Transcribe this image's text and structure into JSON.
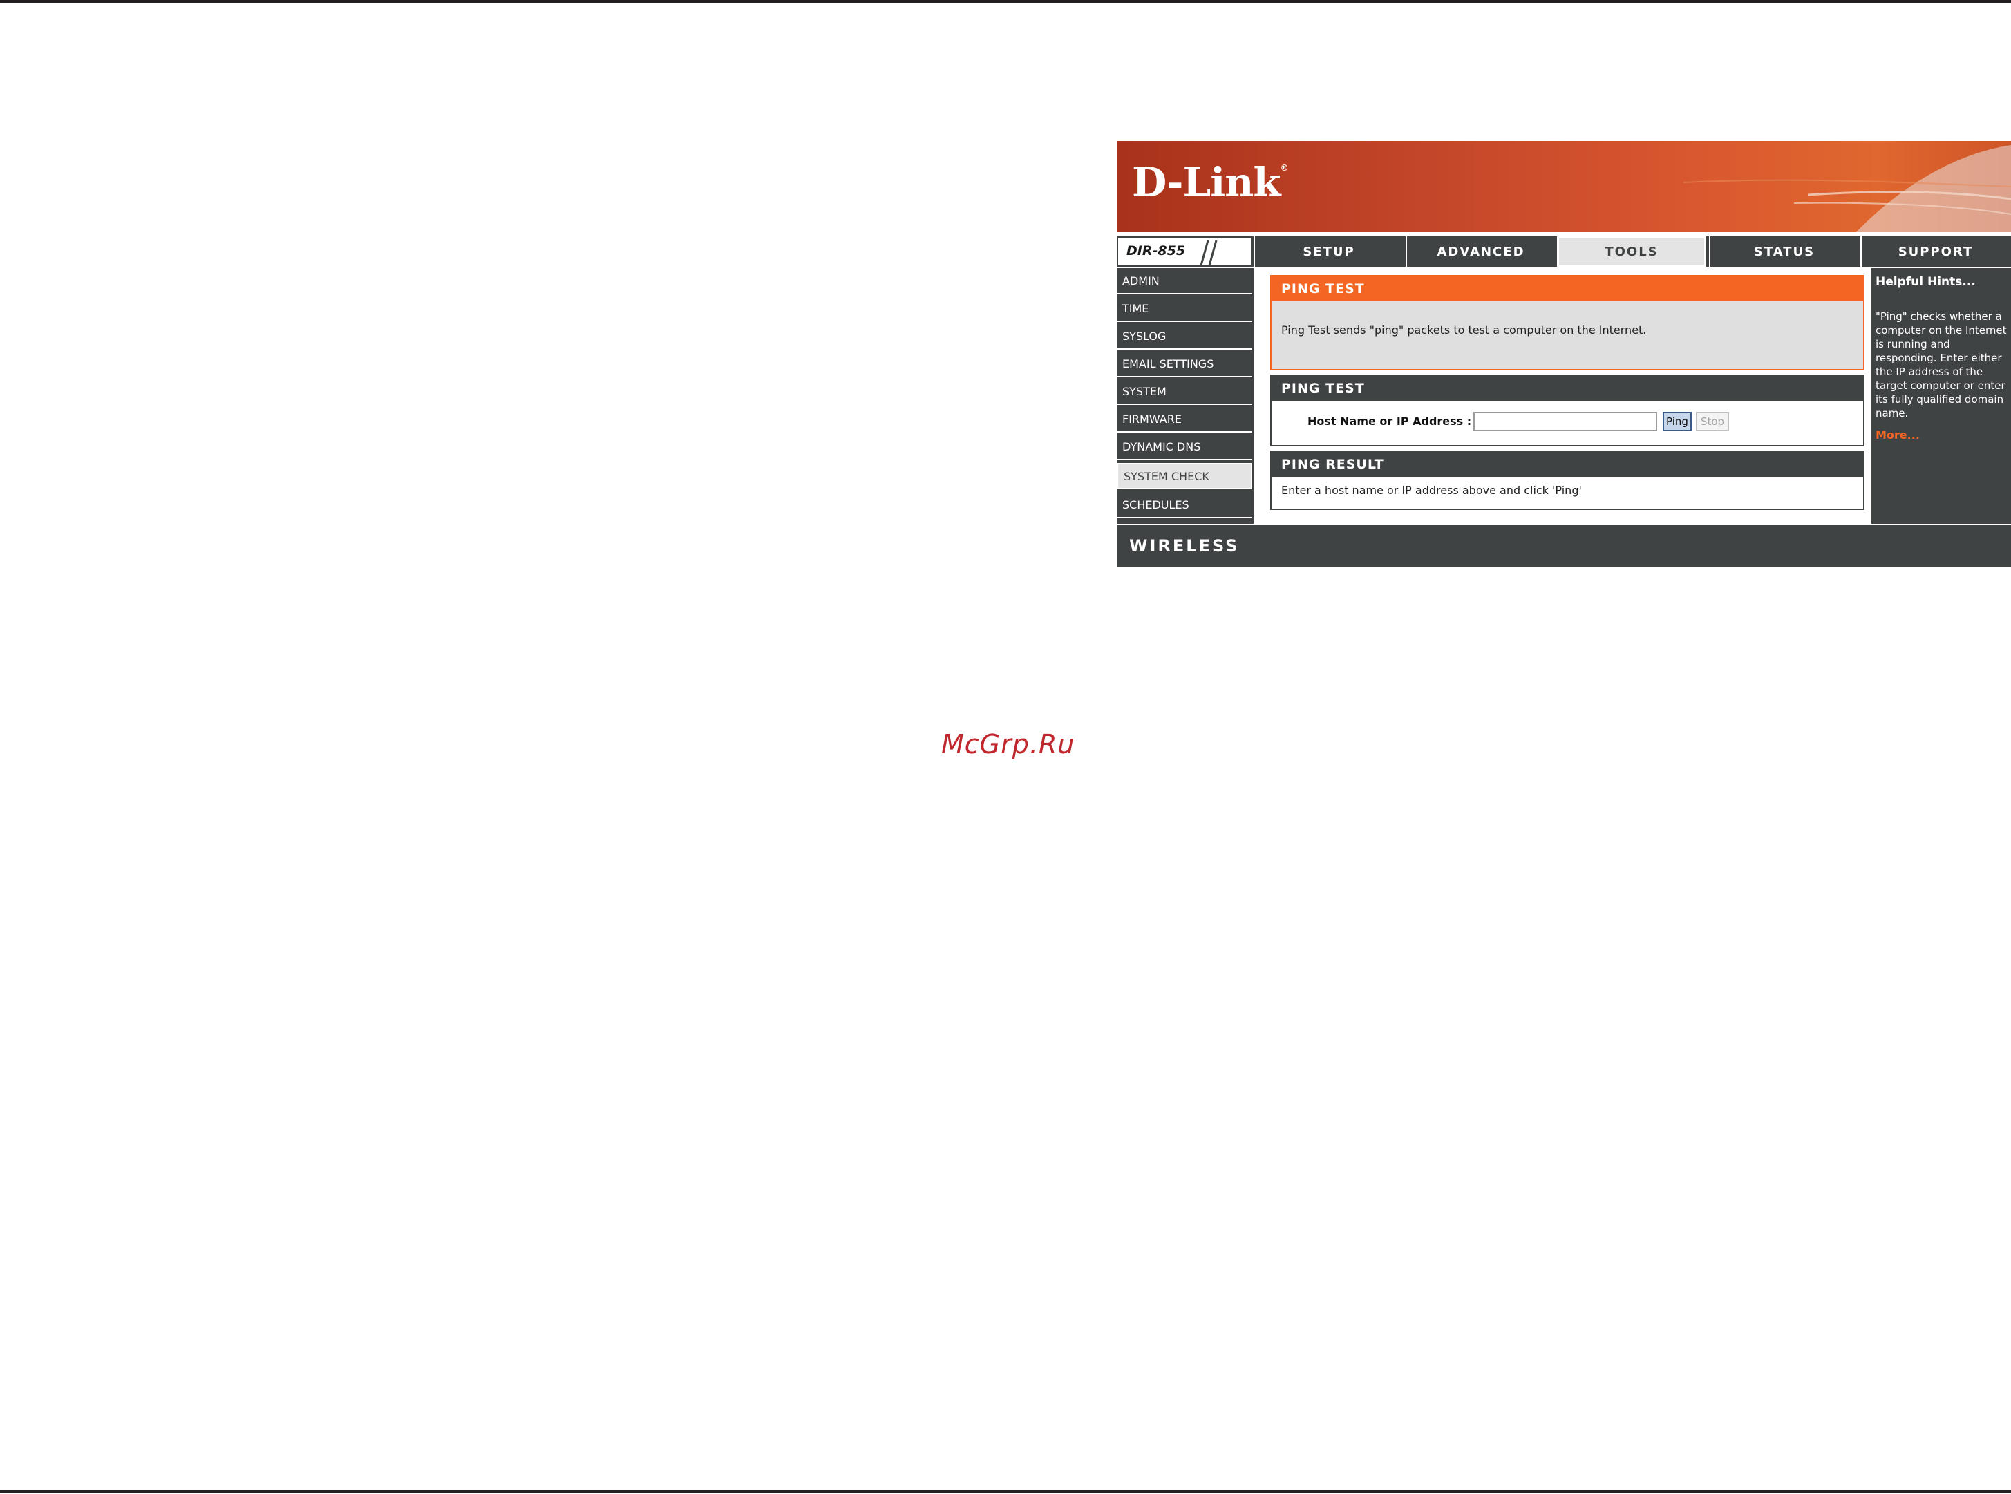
{
  "brand": {
    "logo": "D-Link",
    "registered": "®"
  },
  "model": "DIR-855",
  "nav": {
    "tabs": [
      {
        "label": "SETUP",
        "active": false
      },
      {
        "label": "ADVANCED",
        "active": false
      },
      {
        "label": "TOOLS",
        "active": true
      },
      {
        "label": "STATUS",
        "active": false
      },
      {
        "label": "SUPPORT",
        "active": false
      }
    ]
  },
  "sidebar": {
    "items": [
      {
        "label": "ADMIN"
      },
      {
        "label": "TIME"
      },
      {
        "label": "SYSLOG"
      },
      {
        "label": "EMAIL SETTINGS"
      },
      {
        "label": "SYSTEM"
      },
      {
        "label": "FIRMWARE"
      },
      {
        "label": "DYNAMIC DNS"
      },
      {
        "label": "SYSTEM CHECK",
        "active": true
      },
      {
        "label": "SCHEDULES"
      }
    ]
  },
  "main": {
    "intro": {
      "title": "PING TEST",
      "text": "Ping Test sends \"ping\" packets to test a computer on the Internet."
    },
    "ping_test": {
      "title": "PING TEST",
      "host_label": "Host Name or IP Address :",
      "host_value": "",
      "ping_button": "Ping",
      "stop_button": "Stop"
    },
    "ping_result": {
      "title": "PING RESULT",
      "text": "Enter a host name or IP address above and click 'Ping'"
    }
  },
  "hints": {
    "title": "Helpful Hints...",
    "body": "\"Ping\" checks whether a computer on the Internet is running and responding. Enter either the IP address of the target computer or enter its fully qualified domain name.",
    "more": "More..."
  },
  "footer": {
    "label": "WIRELESS"
  },
  "watermark": "McGrp.Ru",
  "colors": {
    "accent": "#f26522",
    "dark": "#404344",
    "banner": "#c4462a",
    "watermark": "#c0272d"
  }
}
